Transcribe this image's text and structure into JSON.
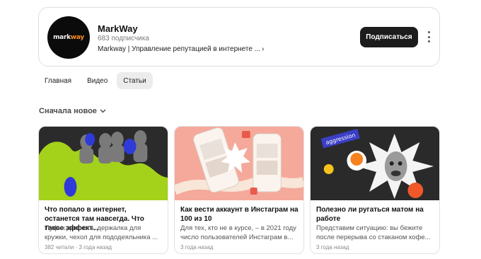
{
  "channel": {
    "name": "MarkWay",
    "subscribers": "683 подписчика",
    "description": "Markway | Управление репутацией в интернете ...",
    "logo_text": "markway",
    "subscribe_label": "Подписаться"
  },
  "tabs": [
    {
      "label": "Главная",
      "active": false
    },
    {
      "label": "Видео",
      "active": false
    },
    {
      "label": "Статьи",
      "active": true
    }
  ],
  "sort": {
    "label": "Сначала новое"
  },
  "articles": [
    {
      "title": "Что попало в интернет, останется там навсегда. Что такое эффект...",
      "snippet": "Пуфик для кота, держалка для кружки, чехол для пододеяльника ...",
      "meta": "382 читали · 3 года назад"
    },
    {
      "title": "Как вести аккаунт в Инстаграм на 100 из 10",
      "snippet": "Для тех, кто не в курсе, – в 2021 году число пользователей Инстаграм в...",
      "meta": "3 года назад"
    },
    {
      "title": "Полезно ли ругаться матом на работе",
      "snippet": "Представим ситуацию: вы бежите после перерыва со стаканом кофе...",
      "meta": "3 года назад",
      "image_tag": "aggression"
    }
  ],
  "colors": {
    "subscribe_bg": "#1c1c1c",
    "logo_accent": "#ff8a1f",
    "card1_bg": "#2b2b2b",
    "card1_green": "#a4d21a",
    "card2_bg": "#f5a99a",
    "card3_bg": "#2a2a2a"
  }
}
